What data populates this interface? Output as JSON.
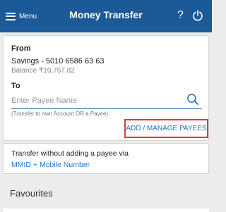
{
  "header": {
    "menu_label": "Menu",
    "title": "Money Transfer",
    "help_glyph": "?"
  },
  "from": {
    "label": "From",
    "account": "Savings - 5010 6586 63 63",
    "balance": "Balance ₹10,767.82"
  },
  "to": {
    "label": "To",
    "placeholder": "Enter Payee Name",
    "value": "",
    "hint": "(Transfer to own Account OR a Payee)",
    "manage_label": "ADD / MANAGE PAYEES"
  },
  "quick_transfer": {
    "text": "Transfer without adding a payee via",
    "link": "MMID + Mobile Number"
  },
  "favourites": {
    "title": "Favourites"
  },
  "colors": {
    "header_bg": "#1c5a97",
    "link": "#1f74cf",
    "highlight_border": "#e0393e"
  }
}
